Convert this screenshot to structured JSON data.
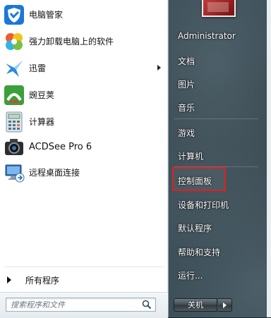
{
  "programs": [
    {
      "label": "电脑管家",
      "icon": "shield-icon",
      "submenu": false
    },
    {
      "label": "强力卸载电脑上的软件",
      "icon": "flower-icon",
      "submenu": false
    },
    {
      "label": "迅雷",
      "icon": "bird-icon",
      "submenu": true
    },
    {
      "label": "豌豆荚",
      "icon": "pea-icon",
      "submenu": false
    },
    {
      "label": "计算器",
      "icon": "calculator-icon",
      "submenu": false
    },
    {
      "label": "ACDSee Pro 6",
      "icon": "camera-icon",
      "submenu": false
    },
    {
      "label": "远程桌面连接",
      "icon": "remote-desktop-icon",
      "submenu": false
    }
  ],
  "all_programs": "所有程序",
  "search": {
    "placeholder": "搜索程序和文件"
  },
  "right_links": [
    "Administrator",
    "文档",
    "图片",
    "音乐",
    "游戏",
    "计算机",
    "控制面板",
    "设备和打印机",
    "默认程序",
    "帮助和支持",
    "运行..."
  ],
  "shutdown": {
    "label": "关机"
  },
  "colors": {
    "highlight": "#e02020",
    "pane": "#ffffff"
  }
}
